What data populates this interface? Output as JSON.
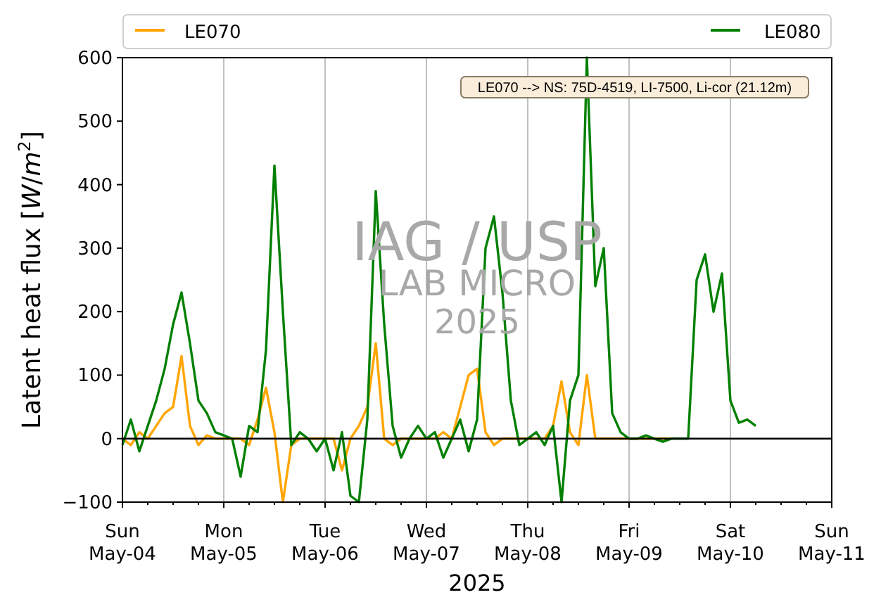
{
  "chart_data": {
    "type": "line",
    "xlabel": "2025",
    "ylabel": "Latent heat flux [*W*/*m*$^{2}$]",
    "categories": [
      "Sun\nMay-04",
      null,
      null,
      null,
      null,
      null,
      null,
      null,
      null,
      null,
      null,
      null,
      "Mon\nMay-05",
      null,
      null,
      null,
      null,
      null,
      null,
      null,
      null,
      null,
      null,
      null,
      "Tue\nMay-06",
      null,
      null,
      null,
      null,
      null,
      null,
      null,
      null,
      null,
      null,
      null,
      "Wed\nMay-07",
      null,
      null,
      null,
      null,
      null,
      null,
      null,
      null,
      null,
      null,
      null,
      "Thu\nMay-08",
      null,
      null,
      null,
      null,
      null,
      null,
      null,
      null,
      null,
      null,
      null,
      "Fri\nMay-09",
      null,
      null,
      null,
      null,
      null,
      null,
      null,
      null,
      null,
      null,
      null,
      "Sat\nMay-10",
      null,
      null,
      null,
      null,
      null,
      null,
      null,
      null,
      null,
      null,
      null,
      "Sun\nMay-11"
    ],
    "series": [
      {
        "name": "LE070",
        "color": "#ffa500",
        "values": [
          0,
          -10,
          10,
          0,
          20,
          40,
          50,
          130,
          20,
          -10,
          5,
          0,
          0,
          0,
          0,
          -10,
          30,
          80,
          10,
          -100,
          -10,
          0,
          0,
          0,
          0,
          0,
          -50,
          0,
          20,
          50,
          150,
          0,
          -10,
          0,
          0,
          0,
          0,
          0,
          10,
          0,
          50,
          100,
          110,
          10,
          -10,
          0,
          0,
          0,
          0,
          0,
          0,
          20,
          90,
          10,
          -10,
          100,
          0,
          0,
          0,
          0,
          0,
          0,
          0,
          0,
          0,
          0,
          null,
          null,
          null,
          null,
          null,
          null,
          null,
          null,
          null,
          null,
          null,
          null,
          null,
          null,
          null,
          null,
          null,
          null,
          null
        ]
      },
      {
        "name": "LE080",
        "color": "#008000",
        "values": [
          -10,
          30,
          -20,
          20,
          60,
          110,
          180,
          230,
          150,
          60,
          40,
          10,
          5,
          0,
          -60,
          20,
          10,
          140,
          430,
          200,
          -10,
          10,
          0,
          -20,
          0,
          -50,
          10,
          -90,
          -100,
          30,
          390,
          180,
          20,
          -30,
          0,
          20,
          0,
          10,
          -30,
          0,
          30,
          -20,
          30,
          300,
          350,
          230,
          60,
          -10,
          0,
          10,
          -10,
          20,
          -100,
          60,
          100,
          600,
          240,
          300,
          40,
          10,
          0,
          0,
          5,
          0,
          -5,
          0,
          0,
          0,
          250,
          290,
          200,
          260,
          60,
          25,
          30,
          20,
          null,
          null,
          null,
          null,
          null,
          null,
          null,
          null,
          null
        ]
      }
    ],
    "ylim": [
      -100,
      600
    ],
    "yticks": [
      {
        "value": -100,
        "label": "−100"
      },
      0,
      100,
      200,
      300,
      400,
      500,
      600
    ],
    "grid": true,
    "legend": true,
    "ref_lines": [
      {
        "axis": "y",
        "value": 0
      }
    ],
    "annotations": [
      {
        "text": "LE070 --> NS: 75D-4519, LI-7500, Li-cor (21.12m)"
      }
    ]
  },
  "watermark": [
    "IAG / USP",
    "LAB MICRO",
    "2025"
  ]
}
